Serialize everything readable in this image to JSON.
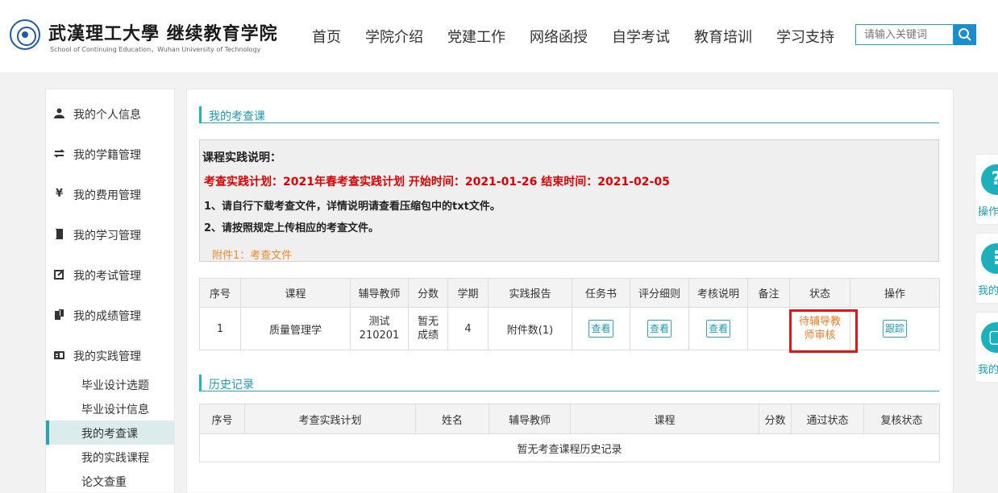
{
  "header": {
    "logo_cn": "武漢理工大學 继续教育学院",
    "logo_en": "School of Continuing Education，Wuhan University of Technology",
    "nav": [
      "首页",
      "学院介绍",
      "党建工作",
      "网络函授",
      "自学考试",
      "教育培训",
      "学习支持"
    ],
    "search_placeholder": "请输入关键词"
  },
  "sidebar": {
    "items": [
      {
        "label": "我的个人信息",
        "icon": "user-icon"
      },
      {
        "label": "我的学籍管理",
        "icon": "swap-icon"
      },
      {
        "label": "我的费用管理",
        "icon": "yen-icon"
      },
      {
        "label": "我的学习管理",
        "icon": "book-icon"
      },
      {
        "label": "我的考试管理",
        "icon": "edit-icon"
      },
      {
        "label": "我的成绩管理",
        "icon": "report-icon"
      },
      {
        "label": "我的实践管理",
        "icon": "practice-icon"
      }
    ],
    "sub_items": [
      "毕业设计选题",
      "毕业设计信息",
      "我的考查课",
      "我的实践课程",
      "论文查重"
    ],
    "active_sub": "我的考查课"
  },
  "main": {
    "section_title": "我的考查课",
    "notice": {
      "title": "课程实践说明：",
      "plan_line": "考查实践计划：2021年春考查实践计划  开始时间：2021-01-26  结束时间：2021-02-05",
      "line1": "1、请自行下载考查文件，详情说明请查看压缩包中的txt文件。",
      "line2": "2、请按照规定上传相应的考查文件。",
      "attachment": "附件1：考查文件"
    },
    "table": {
      "headers": [
        "序号",
        "课程",
        "辅导教师",
        "分数",
        "学期",
        "实践报告",
        "任务书",
        "评分细则",
        "考核说明",
        "备注",
        "状态",
        "操作"
      ],
      "row": {
        "index": "1",
        "course": "质量管理学",
        "teacher_line1": "测试",
        "teacher_line2": "210201",
        "score_line1": "暂无",
        "score_line2": "成绩",
        "term": "4",
        "report": "附件数(1)",
        "task_btn": "查看",
        "criteria_btn": "查看",
        "assess_btn": "查看",
        "remark": "",
        "status_line1": "待辅导教",
        "status_line2": "师审核",
        "action_btn": "跟踪"
      }
    },
    "history_title": "历史记录",
    "history": {
      "headers": [
        "序号",
        "考查实践计划",
        "姓名",
        "辅导教师",
        "课程",
        "分数",
        "通过状态",
        "复核状态"
      ],
      "empty": "暂无考查课程历史记录"
    }
  },
  "float": {
    "labels": [
      "操作",
      "我的",
      "我的"
    ]
  }
}
